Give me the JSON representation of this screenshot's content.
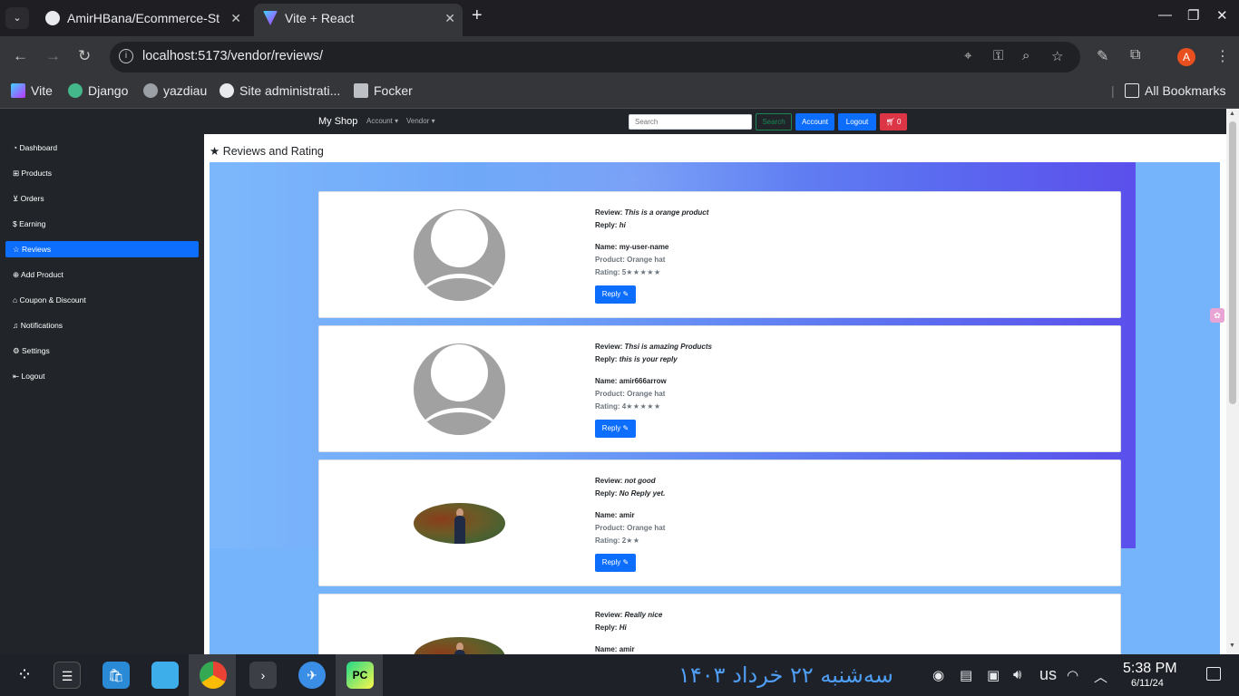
{
  "browser": {
    "tabs": [
      {
        "title": "AmirHBana/Ecommerce-St"
      },
      {
        "title": "Vite + React"
      }
    ],
    "new_tab": "+",
    "url": "localhost:5173/vendor/reviews/",
    "bookmarks": [
      "Vite",
      "Django",
      "yazdiau",
      "Site administrati...",
      "Focker"
    ],
    "all_bookmarks": "All Bookmarks",
    "profile_initial": "A"
  },
  "nav": {
    "brand": "My Shop",
    "account": "Account",
    "vendor": "Vendor",
    "search_placeholder": "Search",
    "search_button": "Search",
    "account_button": "Account",
    "logout_button": "Logout",
    "cart_count": "0"
  },
  "sidebar": {
    "items": [
      {
        "label": "Dashboard",
        "icon": "speedometer-icon"
      },
      {
        "label": "Products",
        "icon": "grid-icon"
      },
      {
        "label": "Orders",
        "icon": "cart-icon"
      },
      {
        "label": "Earning",
        "icon": "currency-icon"
      },
      {
        "label": "Reviews",
        "icon": "star-icon",
        "active": true
      },
      {
        "label": "Add Product",
        "icon": "plus-circle-icon"
      },
      {
        "label": "Coupon & Discount",
        "icon": "tag-icon"
      },
      {
        "label": "Notifications",
        "icon": "bell-icon"
      },
      {
        "label": "Settings",
        "icon": "gear-icon"
      },
      {
        "label": "Logout",
        "icon": "logout-icon"
      }
    ]
  },
  "main": {
    "heading": "Reviews and Rating",
    "labels": {
      "review": "Review:",
      "reply": "Reply:",
      "name": "Name:",
      "product": "Product:",
      "rating": "Rating:"
    },
    "reply_button": "Reply",
    "reviews": [
      {
        "review": "This is a orange product",
        "reply": "hi",
        "name": "my-user-name",
        "product": "Orange hat",
        "rating": "5",
        "stars": "★★★★★",
        "avatar": "default"
      },
      {
        "review": "Thsi is amazing Products",
        "reply": "this is your reply",
        "name": "amir666arrow",
        "product": "Orange hat",
        "rating": "4",
        "stars": "★★★★★",
        "avatar": "default"
      },
      {
        "review": "not good",
        "reply": "No Reply yet.",
        "name": "amir",
        "product": "Orange hat",
        "rating": "2",
        "stars": "★★",
        "avatar": "photo"
      },
      {
        "review": "Really nice",
        "reply": "Hi",
        "name": "amir",
        "product": "",
        "rating": "",
        "stars": "",
        "avatar": "photo"
      }
    ]
  },
  "taskbar": {
    "persian_date": "سه‌شنبه ۲۲ خرداد ۱۴۰۳",
    "keyboard_layout": "us",
    "time": "5:38 PM",
    "date": "6/11/24"
  },
  "colors": {
    "primary": "#0d6efd",
    "danger": "#dc3545",
    "success": "#198754",
    "dark": "#212529"
  }
}
